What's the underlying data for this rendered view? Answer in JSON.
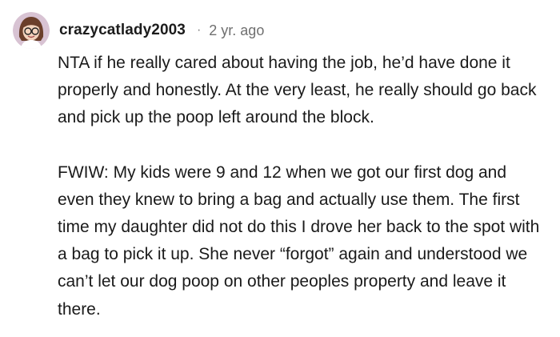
{
  "comment": {
    "author": "crazycatlady2003",
    "separator": "·",
    "timestamp": "2 yr. ago",
    "avatar_icon": "cartoon-girl-with-glasses-avatar",
    "paragraphs": [
      "NTA if he really cared about having the job, he’d have done it properly and honestly. At the very least, he really should go back and pick up the poop left around the block.",
      "FWIW: My kids were 9 and 12 when we got our first dog and even they knew to bring a bag and actually use them. The first time my daughter did not do this I drove her back to the spot with a bag to pick it up. She never “forgot” again and understood we can’t let our dog poop on other peoples property and leave it there."
    ]
  },
  "colors": {
    "text": "#1a1a1a",
    "meta": "#6f6f6f",
    "avatar_background": "#d8c3d3",
    "hair": "#6b3f2b"
  }
}
